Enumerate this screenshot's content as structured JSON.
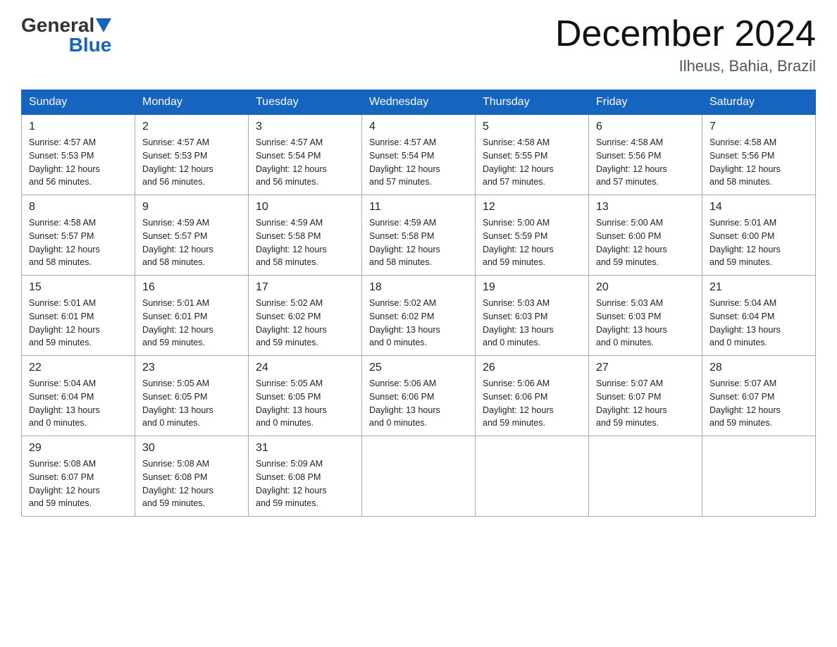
{
  "logo": {
    "general": "General",
    "blue": "Blue"
  },
  "title": "December 2024",
  "location": "Ilheus, Bahia, Brazil",
  "days_of_week": [
    "Sunday",
    "Monday",
    "Tuesday",
    "Wednesday",
    "Thursday",
    "Friday",
    "Saturday"
  ],
  "weeks": [
    [
      {
        "day": "1",
        "sunrise": "4:57 AM",
        "sunset": "5:53 PM",
        "daylight": "12 hours and 56 minutes."
      },
      {
        "day": "2",
        "sunrise": "4:57 AM",
        "sunset": "5:53 PM",
        "daylight": "12 hours and 56 minutes."
      },
      {
        "day": "3",
        "sunrise": "4:57 AM",
        "sunset": "5:54 PM",
        "daylight": "12 hours and 56 minutes."
      },
      {
        "day": "4",
        "sunrise": "4:57 AM",
        "sunset": "5:54 PM",
        "daylight": "12 hours and 57 minutes."
      },
      {
        "day": "5",
        "sunrise": "4:58 AM",
        "sunset": "5:55 PM",
        "daylight": "12 hours and 57 minutes."
      },
      {
        "day": "6",
        "sunrise": "4:58 AM",
        "sunset": "5:56 PM",
        "daylight": "12 hours and 57 minutes."
      },
      {
        "day": "7",
        "sunrise": "4:58 AM",
        "sunset": "5:56 PM",
        "daylight": "12 hours and 58 minutes."
      }
    ],
    [
      {
        "day": "8",
        "sunrise": "4:58 AM",
        "sunset": "5:57 PM",
        "daylight": "12 hours and 58 minutes."
      },
      {
        "day": "9",
        "sunrise": "4:59 AM",
        "sunset": "5:57 PM",
        "daylight": "12 hours and 58 minutes."
      },
      {
        "day": "10",
        "sunrise": "4:59 AM",
        "sunset": "5:58 PM",
        "daylight": "12 hours and 58 minutes."
      },
      {
        "day": "11",
        "sunrise": "4:59 AM",
        "sunset": "5:58 PM",
        "daylight": "12 hours and 58 minutes."
      },
      {
        "day": "12",
        "sunrise": "5:00 AM",
        "sunset": "5:59 PM",
        "daylight": "12 hours and 59 minutes."
      },
      {
        "day": "13",
        "sunrise": "5:00 AM",
        "sunset": "6:00 PM",
        "daylight": "12 hours and 59 minutes."
      },
      {
        "day": "14",
        "sunrise": "5:01 AM",
        "sunset": "6:00 PM",
        "daylight": "12 hours and 59 minutes."
      }
    ],
    [
      {
        "day": "15",
        "sunrise": "5:01 AM",
        "sunset": "6:01 PM",
        "daylight": "12 hours and 59 minutes."
      },
      {
        "day": "16",
        "sunrise": "5:01 AM",
        "sunset": "6:01 PM",
        "daylight": "12 hours and 59 minutes."
      },
      {
        "day": "17",
        "sunrise": "5:02 AM",
        "sunset": "6:02 PM",
        "daylight": "12 hours and 59 minutes."
      },
      {
        "day": "18",
        "sunrise": "5:02 AM",
        "sunset": "6:02 PM",
        "daylight": "13 hours and 0 minutes."
      },
      {
        "day": "19",
        "sunrise": "5:03 AM",
        "sunset": "6:03 PM",
        "daylight": "13 hours and 0 minutes."
      },
      {
        "day": "20",
        "sunrise": "5:03 AM",
        "sunset": "6:03 PM",
        "daylight": "13 hours and 0 minutes."
      },
      {
        "day": "21",
        "sunrise": "5:04 AM",
        "sunset": "6:04 PM",
        "daylight": "13 hours and 0 minutes."
      }
    ],
    [
      {
        "day": "22",
        "sunrise": "5:04 AM",
        "sunset": "6:04 PM",
        "daylight": "13 hours and 0 minutes."
      },
      {
        "day": "23",
        "sunrise": "5:05 AM",
        "sunset": "6:05 PM",
        "daylight": "13 hours and 0 minutes."
      },
      {
        "day": "24",
        "sunrise": "5:05 AM",
        "sunset": "6:05 PM",
        "daylight": "13 hours and 0 minutes."
      },
      {
        "day": "25",
        "sunrise": "5:06 AM",
        "sunset": "6:06 PM",
        "daylight": "13 hours and 0 minutes."
      },
      {
        "day": "26",
        "sunrise": "5:06 AM",
        "sunset": "6:06 PM",
        "daylight": "12 hours and 59 minutes."
      },
      {
        "day": "27",
        "sunrise": "5:07 AM",
        "sunset": "6:07 PM",
        "daylight": "12 hours and 59 minutes."
      },
      {
        "day": "28",
        "sunrise": "5:07 AM",
        "sunset": "6:07 PM",
        "daylight": "12 hours and 59 minutes."
      }
    ],
    [
      {
        "day": "29",
        "sunrise": "5:08 AM",
        "sunset": "6:07 PM",
        "daylight": "12 hours and 59 minutes."
      },
      {
        "day": "30",
        "sunrise": "5:08 AM",
        "sunset": "6:08 PM",
        "daylight": "12 hours and 59 minutes."
      },
      {
        "day": "31",
        "sunrise": "5:09 AM",
        "sunset": "6:08 PM",
        "daylight": "12 hours and 59 minutes."
      },
      null,
      null,
      null,
      null
    ]
  ],
  "labels": {
    "sunrise": "Sunrise:",
    "sunset": "Sunset:",
    "daylight": "Daylight:"
  }
}
